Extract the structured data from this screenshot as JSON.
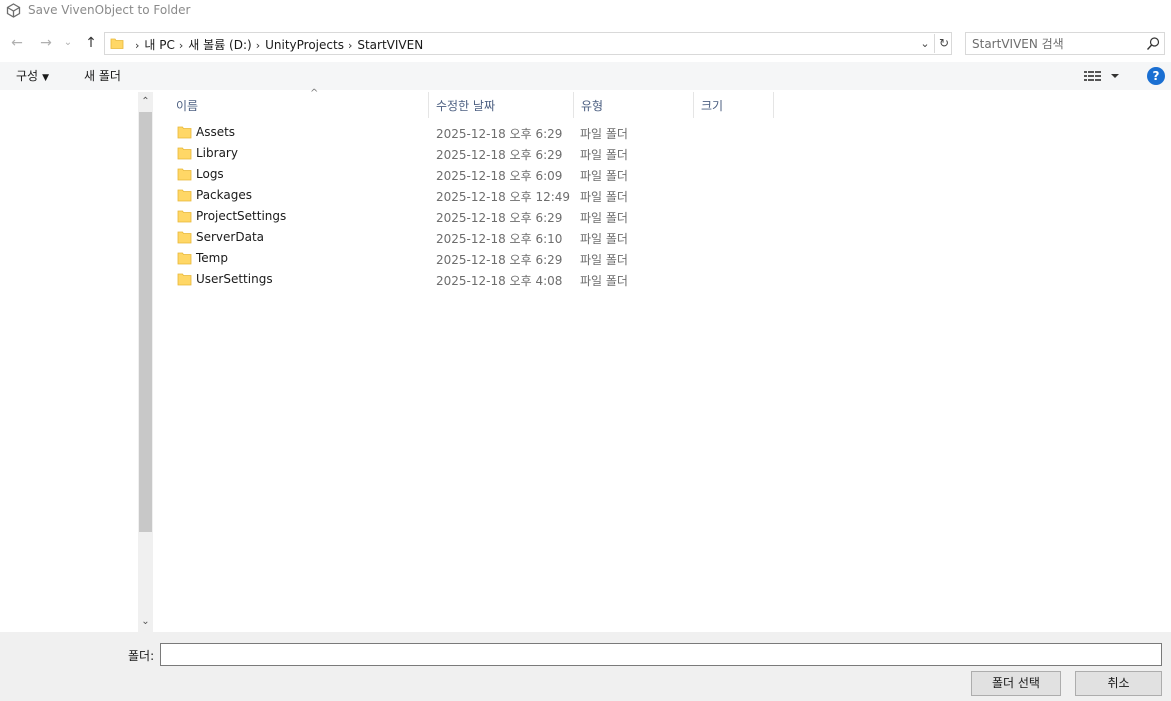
{
  "window": {
    "title": "Save VivenObject to Folder"
  },
  "nav": {
    "back": "←",
    "forward": "→",
    "recent": "⌄",
    "up": "↑"
  },
  "address": {
    "crumbs": [
      "내 PC",
      "새 볼륨 (D:)",
      "UnityProjects",
      "StartVIVEN"
    ],
    "separator": "›",
    "dropdown_glyph": "⌄",
    "refresh_glyph": "↻"
  },
  "search": {
    "placeholder": "StartVIVEN 검색"
  },
  "toolbar": {
    "organize": "구성",
    "organize_caret": "▼",
    "new_folder": "새 폴더",
    "help": "?"
  },
  "columns": {
    "name": "이름",
    "modified": "수정한 날짜",
    "type": "유형",
    "size": "크기",
    "sort_glyph": "^"
  },
  "files": [
    {
      "name": "Assets",
      "modified": "2025-12-18 오후 6:29",
      "type": "파일 폴더"
    },
    {
      "name": "Library",
      "modified": "2025-12-18 오후 6:29",
      "type": "파일 폴더"
    },
    {
      "name": "Logs",
      "modified": "2025-12-18 오후 6:09",
      "type": "파일 폴더"
    },
    {
      "name": "Packages",
      "modified": "2025-12-18 오후 12:49",
      "type": "파일 폴더"
    },
    {
      "name": "ProjectSettings",
      "modified": "2025-12-18 오후 6:29",
      "type": "파일 폴더"
    },
    {
      "name": "ServerData",
      "modified": "2025-12-18 오후 6:10",
      "type": "파일 폴더"
    },
    {
      "name": "Temp",
      "modified": "2025-12-18 오후 6:29",
      "type": "파일 폴더"
    },
    {
      "name": "UserSettings",
      "modified": "2025-12-18 오후 4:08",
      "type": "파일 폴더"
    }
  ],
  "footer": {
    "folder_label": "폴더:",
    "folder_value": "",
    "select_button": "폴더 선택",
    "cancel_button": "취소"
  },
  "colors": {
    "folder": "#ffd766",
    "folder_dark": "#e8b838",
    "help": "#1a6fd2",
    "header_text": "#4d6082"
  }
}
